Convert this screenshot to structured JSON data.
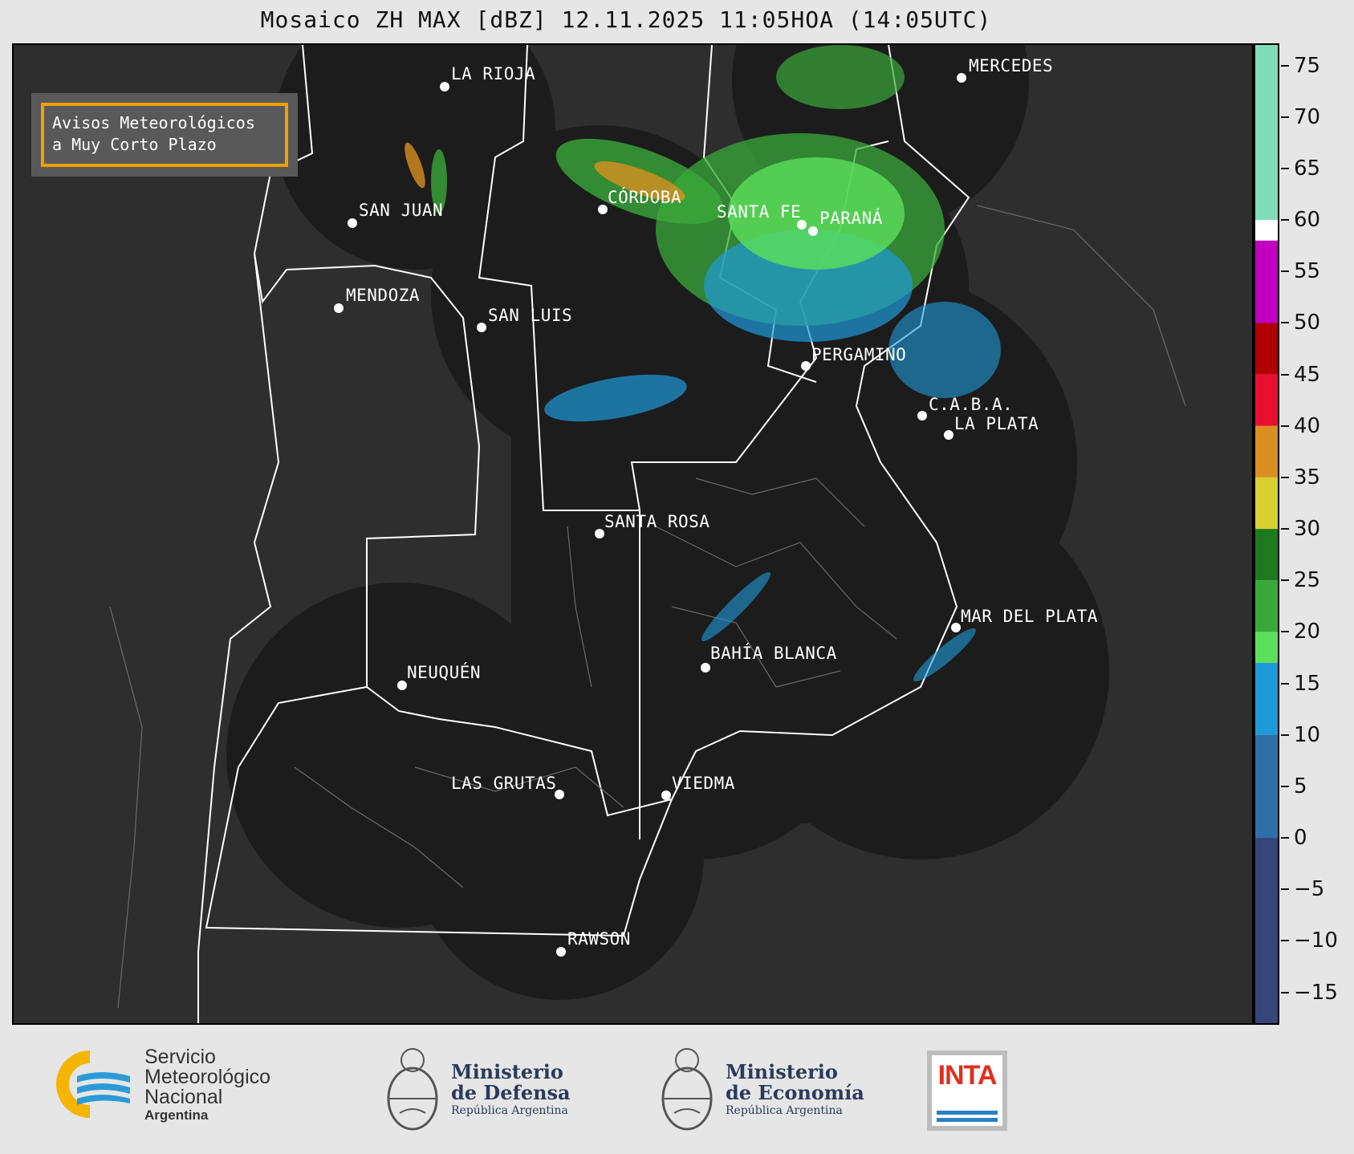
{
  "title": "Mosaico ZH MAX [dBZ] 12.11.2025 11:05HOA (14:05UTC)",
  "notice": {
    "line1": "Avisos Meteorológicos",
    "line2": "a Muy Corto Plazo",
    "border_color": "#f0a000"
  },
  "cities": [
    {
      "name": "LA RIOJA"
    },
    {
      "name": "MERCEDES"
    },
    {
      "name": "SAN JUAN"
    },
    {
      "name": "CÓRDOBA"
    },
    {
      "name": "SANTA FE"
    },
    {
      "name": "PARANÁ"
    },
    {
      "name": "MENDOZA"
    },
    {
      "name": "SAN LUIS"
    },
    {
      "name": "PERGAMINO"
    },
    {
      "name": "C.A.B.A."
    },
    {
      "name": "LA PLATA"
    },
    {
      "name": "SANTA ROSA"
    },
    {
      "name": "MAR DEL PLATA"
    },
    {
      "name": "BAHÍA BLANCA"
    },
    {
      "name": "NEUQUÉN"
    },
    {
      "name": "LAS GRUTAS"
    },
    {
      "name": "VIEDMA"
    },
    {
      "name": "RAWSON"
    }
  ],
  "colorbar": {
    "unit": "dBZ",
    "min": -18,
    "max": 77,
    "ticks": [
      75,
      70,
      65,
      60,
      55,
      50,
      45,
      40,
      35,
      30,
      25,
      20,
      15,
      10,
      5,
      0,
      -5,
      -10,
      -15
    ],
    "tick_labels": [
      "75",
      "70",
      "65",
      "60",
      "55",
      "50",
      "45",
      "40",
      "35",
      "30",
      "25",
      "20",
      "15",
      "10",
      "5",
      "0",
      "−5",
      "−10",
      "−15"
    ],
    "bands": [
      {
        "from": 60,
        "to": 77,
        "color": "#7fdcb8"
      },
      {
        "from": 58,
        "to": 60,
        "color": "#ffffff"
      },
      {
        "from": 50,
        "to": 58,
        "color": "#c000c0"
      },
      {
        "from": 45,
        "to": 50,
        "color": "#b00000"
      },
      {
        "from": 40,
        "to": 45,
        "color": "#e81030"
      },
      {
        "from": 35,
        "to": 40,
        "color": "#d99020"
      },
      {
        "from": 30,
        "to": 35,
        "color": "#d8d030"
      },
      {
        "from": 25,
        "to": 30,
        "color": "#1e7a1e"
      },
      {
        "from": 20,
        "to": 25,
        "color": "#3aa83a"
      },
      {
        "from": 17,
        "to": 20,
        "color": "#5be05b"
      },
      {
        "from": 10,
        "to": 17,
        "color": "#1f9ad8"
      },
      {
        "from": 0,
        "to": 10,
        "color": "#2f6fa8"
      },
      {
        "from": -18,
        "to": 0,
        "color": "#36457a"
      }
    ]
  },
  "logos": {
    "smn_line1": "Servicio",
    "smn_line2": "Meteorológico",
    "smn_line3": "Nacional",
    "smn_line4": "Argentina",
    "defensa_line1": "Ministerio",
    "defensa_line2": "de Defensa",
    "defensa_line3": "República Argentina",
    "economia_line1": "Ministerio",
    "economia_line2": "de Economía",
    "economia_line3": "República Argentina",
    "inta": "INTA"
  }
}
